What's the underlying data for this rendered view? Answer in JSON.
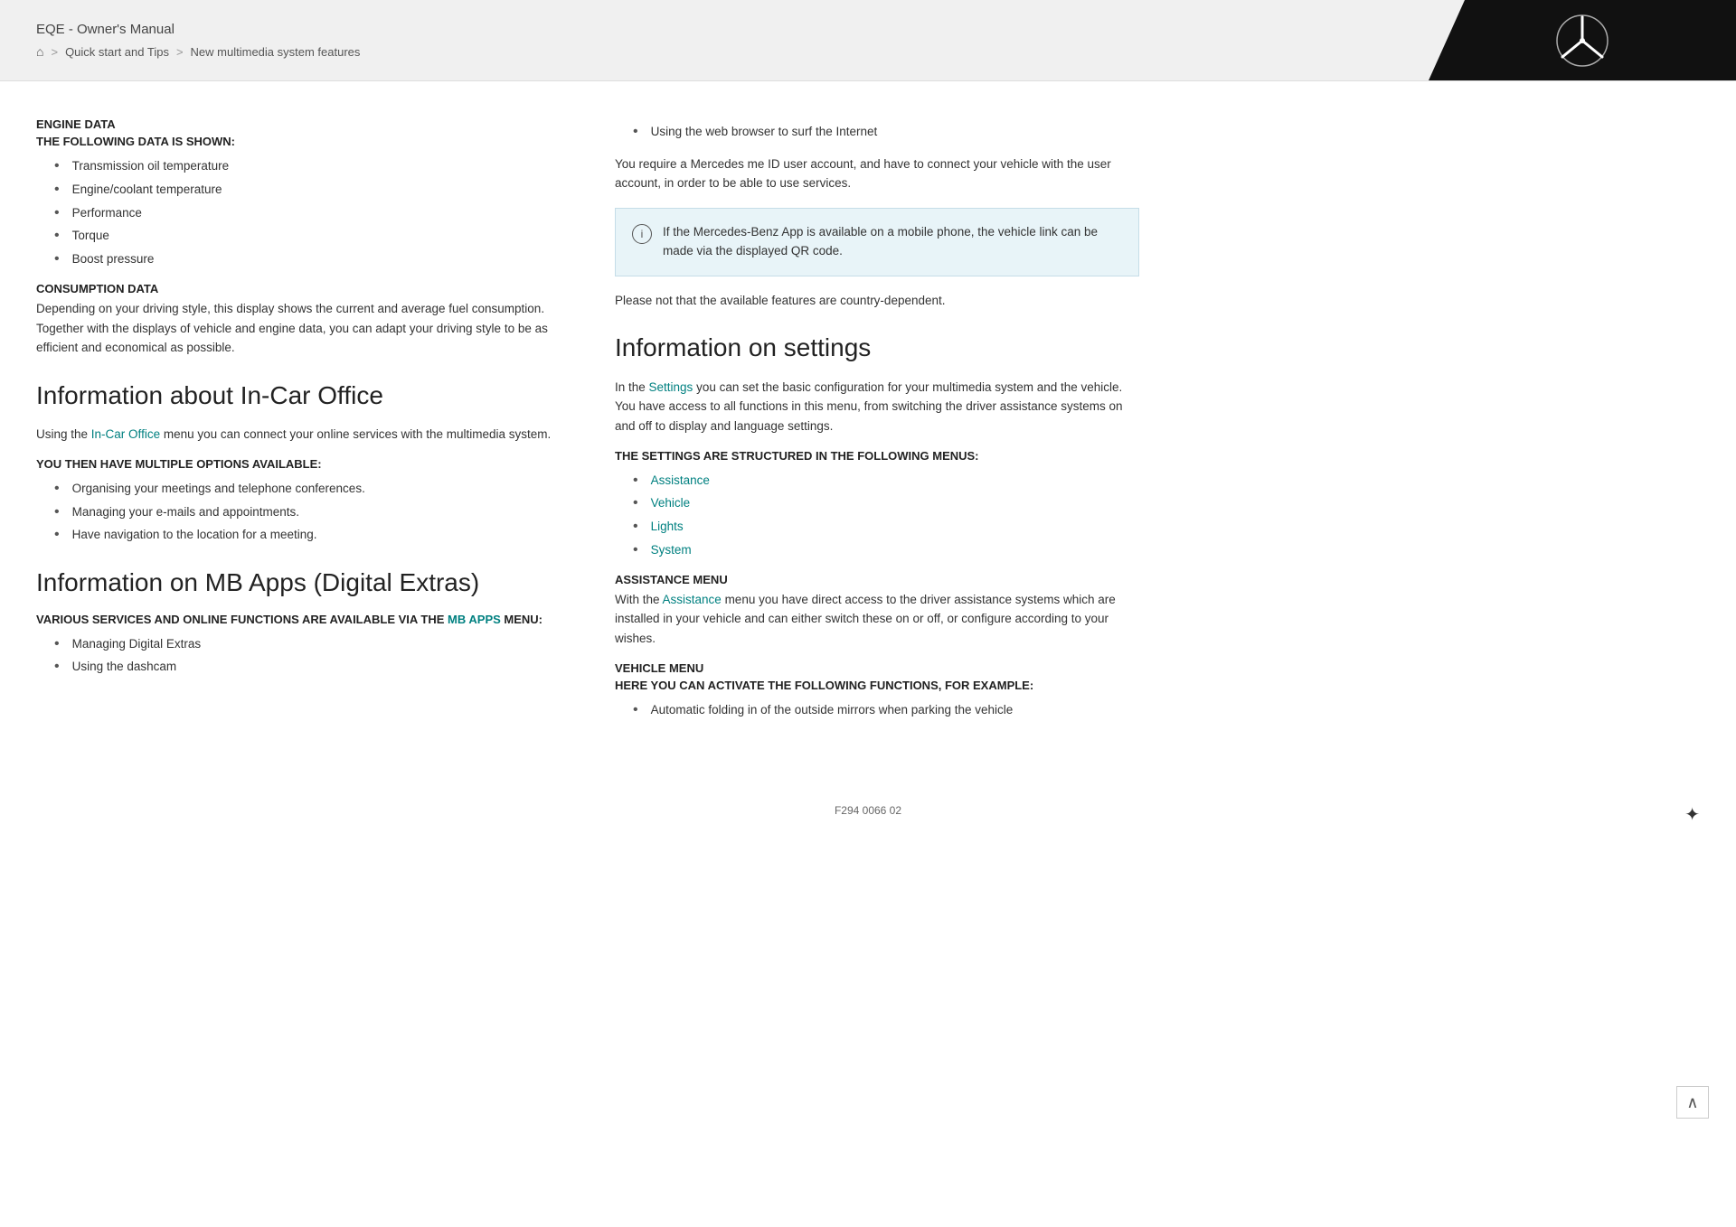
{
  "header": {
    "manual_title": "EQE - Owner's Manual",
    "breadcrumb": {
      "home_icon": "⌂",
      "sep1": ">",
      "item1": "Quick start and Tips",
      "sep2": ">",
      "item2": "New multimedia system features"
    },
    "logo_alt": "Mercedes-Benz Star"
  },
  "left_column": {
    "engine_data": {
      "heading1": "ENGINE DATA",
      "heading2": "THE FOLLOWING DATA IS SHOWN:",
      "items": [
        "Transmission oil temperature",
        "Engine/coolant temperature",
        "Performance",
        "Torque",
        "Boost pressure"
      ]
    },
    "consumption_data": {
      "heading": "CONSUMPTION DATA",
      "para": "Depending on your driving style, this display shows the current and average fuel consumption. Together with the displays of vehicle and engine data, you can adapt your driving style to be as efficient and economical as possible."
    },
    "in_car_office": {
      "title": "Information about In-Car Office",
      "para_prefix": "Using the ",
      "para_link": "In-Car Office",
      "para_suffix": " menu you can connect your online services with the multimedia system.",
      "options_heading": "YOU THEN HAVE MULTIPLE OPTIONS AVAILABLE:",
      "options": [
        "Organising your meetings and telephone conferences.",
        "Managing your e-mails and appointments.",
        "Have navigation to the location for a meeting."
      ]
    },
    "mb_apps": {
      "title": "Information on MB Apps (Digital Extras)",
      "services_heading_prefix": "VARIOUS SERVICES AND ONLINE FUNCTIONS ARE AVAILABLE VIA THE ",
      "services_link": "MB APPS",
      "services_heading_suffix": " MENU:",
      "services": [
        "Managing Digital Extras",
        "Using the dashcam"
      ]
    }
  },
  "right_column": {
    "extra_bullet": "Using the web browser to surf the Internet",
    "mercedes_me_para": "You require a Mercedes me ID user account, and have to connect your vehicle with the user account, in order to be able to use services.",
    "info_box": {
      "icon": "i",
      "text": "If the Mercedes-Benz App is available on a mobile phone, the vehicle link can be made via the displayed QR code."
    },
    "country_note": "Please not that the available features are country-dependent.",
    "settings_title": "Information on settings",
    "settings_para_prefix": "In the ",
    "settings_link": "Settings",
    "settings_para_suffix": " you can set the basic configuration for your multimedia system and the vehicle. You have access to all functions in this menu, from switching the driver assistance systems on and off to display and language settings.",
    "settings_menus_heading": "THE SETTINGS ARE STRUCTURED IN THE FOLLOWING MENUS:",
    "settings_menus": [
      "Assistance",
      "Vehicle",
      "Lights",
      "System"
    ],
    "assistance_menu": {
      "heading": "ASSISTANCE MENU",
      "para_prefix": "With the ",
      "para_link": "Assistance",
      "para_suffix": " menu you have direct access to the driver assistance systems which are installed in your vehicle and can either switch these on or off, or configure according to your wishes."
    },
    "vehicle_menu": {
      "heading": "VEHICLE MENU",
      "sub_heading": "HERE YOU CAN ACTIVATE THE FOLLOWING FUNCTIONS, FOR EXAMPLE:",
      "items": [
        "Automatic folding in of the outside mirrors when parking the vehicle"
      ]
    }
  },
  "footer": {
    "code": "F294 0066 02"
  },
  "ui": {
    "scroll_up_icon": "∧",
    "butterfly_icon": "✦"
  }
}
